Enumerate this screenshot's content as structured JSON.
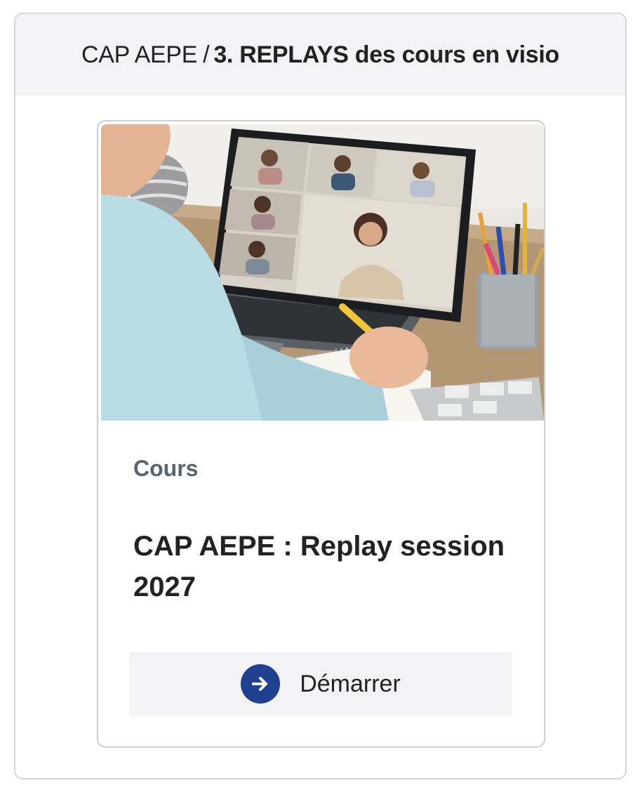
{
  "header": {
    "crumb": "CAP AEPE",
    "separator": "/",
    "section": "3. REPLAYS des cours en visio"
  },
  "card": {
    "type_label": "Cours",
    "title": "CAP AEPE : Replay session 2027",
    "button_label": "Démarrer",
    "button_icon": "arrow-right-circle-icon",
    "image_subject": "laptop-video-call-photo"
  },
  "colors": {
    "header_bg": "#f3f3f5",
    "accent": "#1f3f8f",
    "muted_text": "#5b636d",
    "text": "#222222",
    "border": "#d6d6d8"
  }
}
